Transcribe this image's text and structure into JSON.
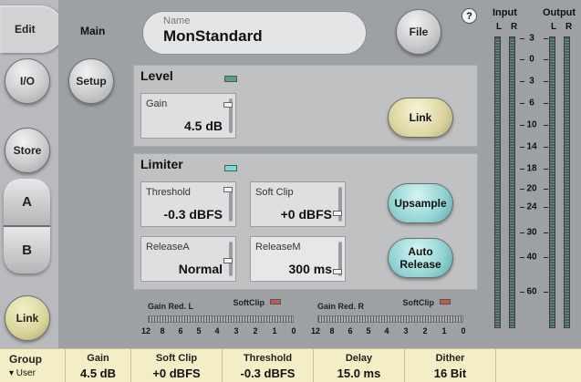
{
  "nav": {
    "edit": "Edit",
    "io": "I/O",
    "store": "Store",
    "a": "A",
    "b": "B",
    "link": "Link",
    "main": "Main",
    "setup": "Setup",
    "file": "File",
    "help": "?"
  },
  "preset": {
    "label": "Name",
    "value": "MonStandard"
  },
  "level": {
    "title": "Level",
    "gain_label": "Gain",
    "gain_value": "4.5 dB",
    "link_label": "Link",
    "led_color": "#5d9c8a"
  },
  "limiter": {
    "title": "Limiter",
    "led_color": "#6fe0d8",
    "threshold_label": "Threshold",
    "threshold_value": "-0.3 dBFS",
    "softclip_label": "Soft Clip",
    "softclip_value": "+0 dBFS",
    "releaseA_label": "ReleaseA",
    "releaseA_value": "Normal",
    "releaseM_label": "ReleaseM",
    "releaseM_value": "300 ms",
    "upsample_label": "Upsample",
    "autorelease_label": "Auto\nRelease"
  },
  "gain_reduction": {
    "left_label": "Gain Red. L",
    "right_label": "Gain Red. R",
    "softclip_label": "SoftClip",
    "scale": [
      "12",
      "8",
      "6",
      "5",
      "4",
      "3",
      "2",
      "1",
      "0"
    ]
  },
  "meters": {
    "input_label": "Input",
    "output_label": "Output",
    "l": "L",
    "r": "R",
    "scale": [
      "3",
      "0",
      "3",
      "6",
      "10",
      "14",
      "18",
      "20",
      "24",
      "30",
      "40",
      "60"
    ]
  },
  "status": {
    "group_label": "Group",
    "group_value": "▾ User",
    "items": [
      {
        "label": "Gain",
        "value": "4.5 dB"
      },
      {
        "label": "Soft Clip",
        "value": "+0 dBFS"
      },
      {
        "label": "Threshold",
        "value": "-0.3 dBFS"
      },
      {
        "label": "Delay",
        "value": "15.0 ms"
      },
      {
        "label": "Dither",
        "value": "16 Bit"
      }
    ]
  },
  "colors": {
    "status_bg": "#f4eec6",
    "softclip_led": "#c45a52",
    "meter_green": "#6d8c7f"
  }
}
